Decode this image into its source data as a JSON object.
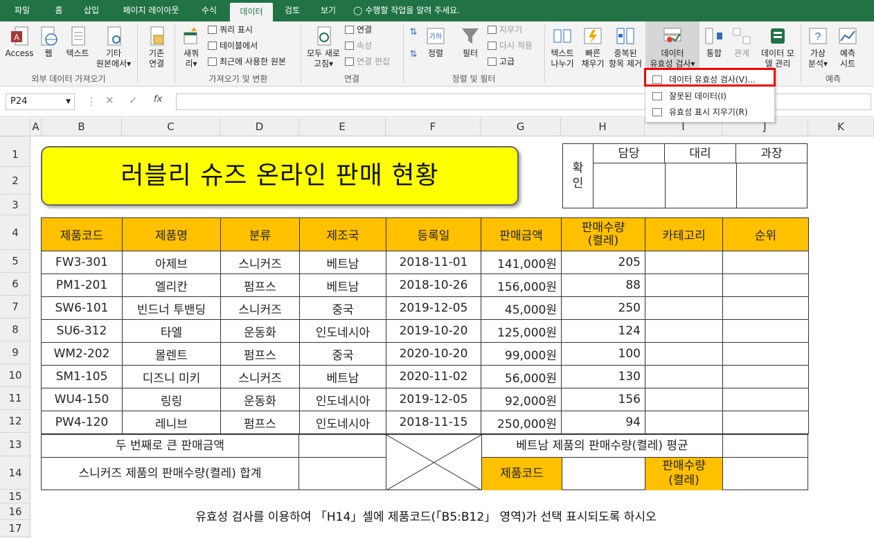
{
  "tabs": [
    "파일",
    "홈",
    "삽입",
    "페이지 레이아웃",
    "수식",
    "데이터",
    "검토",
    "보기"
  ],
  "tell_me": "수행할 작업을 알려 주세요.",
  "ribbon": {
    "access": "Access",
    "web": "웹",
    "text": "텍스트",
    "other1": "기타",
    "other2": "원본에서",
    "existing1": "기존",
    "existing2": "연결",
    "newq1": "새쿼",
    "newq2": "리",
    "query_show": "쿼리 표시",
    "from_table": "테이블에서",
    "recent": "최근에 사용한 원본",
    "refresh1": "모두 새로",
    "refresh2": "고침",
    "conn": "연결",
    "props": "속성",
    "edit_links": "연결 편집",
    "sort": "정렬",
    "filter": "필터",
    "clear": "지우기",
    "reapply": "다시 적용",
    "advanced": "고급",
    "t2c1": "텍스트",
    "t2c2": "나누기",
    "flash1": "빠른",
    "flash2": "채우기",
    "dup1": "중복된",
    "dup2": "항목 제거",
    "dv1": "데이터",
    "dv2": "유효성 검사",
    "consol": "통합",
    "rel": "관계",
    "model1": "데이터 모",
    "model2": "델 관리",
    "whatif1": "가상",
    "whatif2": "분석",
    "forecast1": "예측",
    "forecast2": "시트",
    "groups": [
      "외부 데이터 가져오기",
      "가져오기 및 변환",
      "연결",
      "정렬 및 필터",
      "예측"
    ]
  },
  "dropdown": [
    "데이터 유효성 검사(V)...",
    "잘못된 데이터(I)",
    "유효성 표시 지우기(R)"
  ],
  "namebox": "P24",
  "columns": [
    "A",
    "B",
    "C",
    "D",
    "E",
    "F",
    "G",
    "H",
    "I",
    "J",
    "K"
  ],
  "rows": [
    "1",
    "2",
    "3",
    "4",
    "5",
    "6",
    "7",
    "8",
    "9",
    "10",
    "11",
    "12",
    "13",
    "14",
    "15",
    "16",
    "17"
  ],
  "title": "러블리 슈즈 온라인 판매 현황",
  "approval": {
    "label1": "확",
    "label2": "인",
    "cols": [
      "담당",
      "대리",
      "과장"
    ]
  },
  "headers": [
    "제품코드",
    "제품명",
    "분류",
    "제조국",
    "등록일",
    "판매금액",
    "판매수량",
    "(켤레)",
    "카테고리",
    "순위"
  ],
  "table": [
    [
      "FW3-301",
      "아제브",
      "스니커즈",
      "베트남",
      "2018-11-01",
      "141,000원",
      "205"
    ],
    [
      "PM1-201",
      "엘리칸",
      "펌프스",
      "베트남",
      "2018-10-26",
      "156,000원",
      "88"
    ],
    [
      "SW6-101",
      "빈드너 투밴딩",
      "스니커즈",
      "중국",
      "2019-12-05",
      "45,000원",
      "250"
    ],
    [
      "SU6-312",
      "타엘",
      "운동화",
      "인도네시아",
      "2019-10-20",
      "125,000원",
      "124"
    ],
    [
      "WM2-202",
      "몰렌트",
      "펌프스",
      "중국",
      "2020-10-20",
      "99,000원",
      "100"
    ],
    [
      "SM1-105",
      "디즈니 미키",
      "스니커즈",
      "베트남",
      "2020-11-02",
      "56,000원",
      "130"
    ],
    [
      "WU4-150",
      "링링",
      "운동화",
      "인도네시아",
      "2019-12-05",
      "92,000원",
      "156"
    ],
    [
      "PW4-120",
      "레니브",
      "펌프스",
      "인도네시아",
      "2018-11-15",
      "250,000원",
      "94"
    ]
  ],
  "bottom": {
    "second_largest": "두 번째로 큰 판매금액",
    "sneaker_sum": "스니커즈 제품의 판매수량(켤레) 합계",
    "vietnam_avg": "베트남 제품의 판매수량(켤레) 평균",
    "code": "제품코드",
    "qty1": "판매수량",
    "qty2": "(켤레)"
  },
  "instruction": "유효성 검사를 이용하여 「H14」셀에 제품코드(「B5:B12」 영역)가 선택 표시되도록 하시오",
  "colors": {
    "green": "#217346",
    "orange": "#ffc000",
    "yellow": "#ffff00"
  }
}
